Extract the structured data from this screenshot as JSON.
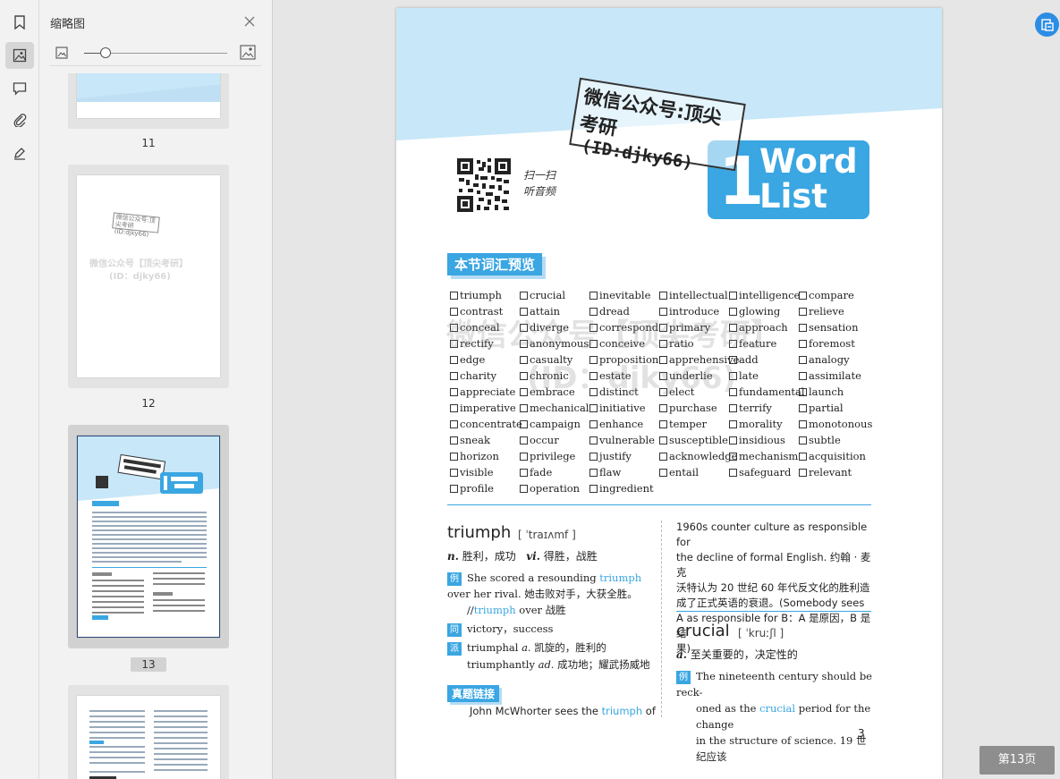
{
  "panel": {
    "title": "缩略图",
    "zoom": 0.15
  },
  "thumbnails": [
    {
      "page": "11"
    },
    {
      "page": "12",
      "stamp": "微信公众号:顶尖考研 (ID:djky66)",
      "watermark_line1": "微信公众号【顶尖考研】",
      "watermark_line2": "(ID：djky66)"
    },
    {
      "page": "13",
      "selected": true
    },
    {
      "page": ""
    }
  ],
  "document": {
    "stamp_line1": "微信公众号:顶尖考研",
    "stamp_line2": "(ID:djky66)",
    "qr_caption_line1": "扫一扫",
    "qr_caption_line2": "听音频",
    "unit_number": "1",
    "unit_title_line1": "Word",
    "unit_title_line2": "List",
    "section_title": "本节词汇预览",
    "watermark_line1": "微信公众号【顶尖考研】",
    "watermark_line2": "(ID：djky66)",
    "word_columns": [
      [
        "triumph",
        "contrast",
        "conceal",
        "rectify",
        "edge",
        "charity",
        "appreciate",
        "imperative",
        "concentrate",
        "sneak",
        "horizon",
        "visible",
        "profile"
      ],
      [
        "crucial",
        "attain",
        "diverge",
        "anonymous",
        "casualty",
        "chronic",
        "embrace",
        "mechanical",
        "campaign",
        "occur",
        "privilege",
        "fade",
        "operation"
      ],
      [
        "inevitable",
        "dread",
        "correspond",
        "conceive",
        "proposition",
        "estate",
        "distinct",
        "initiative",
        "enhance",
        "vulnerable",
        "justify",
        "flaw",
        "ingredient"
      ],
      [
        "intellectual",
        "introduce",
        "primary",
        "ratio",
        "apprehensive",
        "underlie",
        "elect",
        "purchase",
        "temper",
        "susceptible",
        "acknowledge",
        "entail"
      ],
      [
        "intelligence",
        "glowing",
        "approach",
        "feature",
        "add",
        "late",
        "fundamental",
        "terrify",
        "morality",
        "insidious",
        "mechanism",
        "safeguard"
      ],
      [
        "compare",
        "relieve",
        "sensation",
        "foremost",
        "analogy",
        "assimilate",
        "launch",
        "partial",
        "monotonous",
        "subtle",
        "acquisition",
        "relevant"
      ]
    ],
    "entry1": {
      "word": "triumph",
      "pron": "[ ˈtraɪʌmf ]",
      "pos1": "n.",
      "def1": "胜利，成功",
      "pos2": "vi.",
      "def2": "得胜，战胜",
      "ex_badge": "例",
      "ex_pre": "She scored a resounding ",
      "ex_word": "triumph",
      "ex_post": " over her rival.",
      "ex_cn": " 她击败对手，大获全胜。",
      "collocation_pre": "//",
      "collocation_word": "triumph",
      "collocation_post": " over 战胜",
      "syn_badge": "同",
      "syn": "victory，success",
      "der_badge": "派",
      "der_line1_word": "triumphal",
      "der_line1_pos": "a.",
      "der_line1_cn": "凯旋的，胜利的",
      "der_line2_word": "triumphantly",
      "der_line2_pos": "ad.",
      "der_line2_cn": "成功地；耀武扬威地",
      "link_tag": "真题链接",
      "link_text_pre": "John McWhorter sees the ",
      "link_text_word": "triumph",
      "link_text_post": " of"
    },
    "right_col": {
      "line1": "1960s counter culture as responsible for",
      "line2": "the decline of formal English. 约翰 · 麦克",
      "line3": "沃特认为 20 世纪 60 年代反文化的胜利造",
      "line4": "成了正式英语的衰退。(Somebody sees",
      "line5": "A as responsible for B：A 是原因，B 是结",
      "line6": "果)"
    },
    "entry2": {
      "word": "crucial",
      "pron": "[ ˈkruːʃl ]",
      "pos": "a.",
      "def": "至关重要的，决定性的",
      "ex_badge": "例",
      "ex_line1": "The nineteenth century should be reck-",
      "ex_line2_pre": "oned as the ",
      "ex_line2_word": "crucial",
      "ex_line2_post": " period for the change",
      "ex_line3": "in the structure of science. 19 世纪应该"
    },
    "page_number": "3"
  },
  "page_indicator": "第13页",
  "colors": {
    "accent": "#3aa6e2",
    "accent_light": "#c8e7f8",
    "fab": "#2d8de4"
  }
}
